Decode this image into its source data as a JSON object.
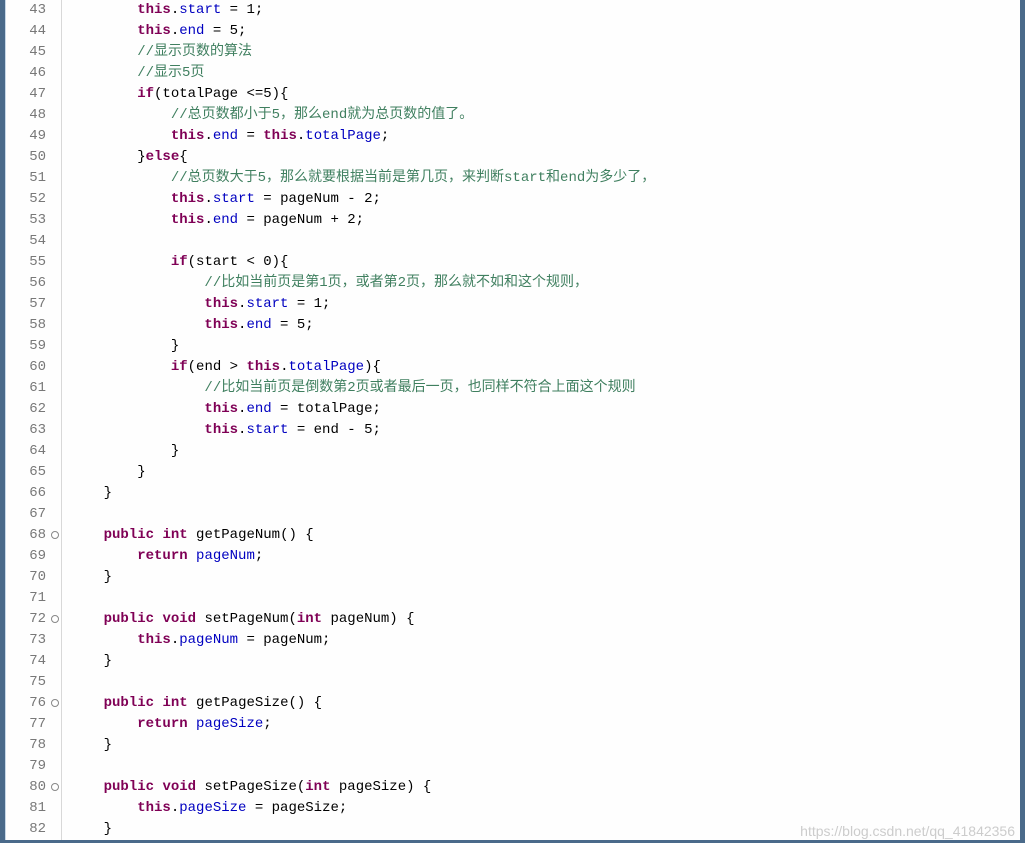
{
  "watermark": "https://blog.csdn.net/qq_41842356",
  "lineStart": 43,
  "lineEnd": 82,
  "foldMarkers": [
    68,
    72,
    76,
    80
  ],
  "code": [
    {
      "n": 43,
      "t": [
        {
          "c": "p",
          "v": "        "
        },
        {
          "c": "kw",
          "v": "this"
        },
        {
          "c": "p",
          "v": "."
        },
        {
          "c": "fld",
          "v": "start"
        },
        {
          "c": "p",
          "v": " = 1;"
        }
      ]
    },
    {
      "n": 44,
      "t": [
        {
          "c": "p",
          "v": "        "
        },
        {
          "c": "kw",
          "v": "this"
        },
        {
          "c": "p",
          "v": "."
        },
        {
          "c": "fld",
          "v": "end"
        },
        {
          "c": "p",
          "v": " = 5;"
        }
      ]
    },
    {
      "n": 45,
      "t": [
        {
          "c": "p",
          "v": "        "
        },
        {
          "c": "cm",
          "v": "//显示页数的算法"
        }
      ]
    },
    {
      "n": 46,
      "t": [
        {
          "c": "p",
          "v": "        "
        },
        {
          "c": "cm",
          "v": "//显示5页"
        }
      ]
    },
    {
      "n": 47,
      "t": [
        {
          "c": "p",
          "v": "        "
        },
        {
          "c": "kw",
          "v": "if"
        },
        {
          "c": "p",
          "v": "(totalPage <=5){"
        }
      ]
    },
    {
      "n": 48,
      "t": [
        {
          "c": "p",
          "v": "            "
        },
        {
          "c": "cm",
          "v": "//总页数都小于5，那么end就为总页数的值了。"
        }
      ]
    },
    {
      "n": 49,
      "t": [
        {
          "c": "p",
          "v": "            "
        },
        {
          "c": "kw",
          "v": "this"
        },
        {
          "c": "p",
          "v": "."
        },
        {
          "c": "fld",
          "v": "end"
        },
        {
          "c": "p",
          "v": " = "
        },
        {
          "c": "kw",
          "v": "this"
        },
        {
          "c": "p",
          "v": "."
        },
        {
          "c": "fld",
          "v": "totalPage"
        },
        {
          "c": "p",
          "v": ";"
        }
      ]
    },
    {
      "n": 50,
      "t": [
        {
          "c": "p",
          "v": "        }"
        },
        {
          "c": "kw",
          "v": "else"
        },
        {
          "c": "p",
          "v": "{"
        }
      ]
    },
    {
      "n": 51,
      "t": [
        {
          "c": "p",
          "v": "            "
        },
        {
          "c": "cm",
          "v": "//总页数大于5，那么就要根据当前是第几页，来判断start和end为多少了，"
        }
      ]
    },
    {
      "n": 52,
      "t": [
        {
          "c": "p",
          "v": "            "
        },
        {
          "c": "kw",
          "v": "this"
        },
        {
          "c": "p",
          "v": "."
        },
        {
          "c": "fld",
          "v": "start"
        },
        {
          "c": "p",
          "v": " = pageNum - 2;"
        }
      ]
    },
    {
      "n": 53,
      "t": [
        {
          "c": "p",
          "v": "            "
        },
        {
          "c": "kw",
          "v": "this"
        },
        {
          "c": "p",
          "v": "."
        },
        {
          "c": "fld",
          "v": "end"
        },
        {
          "c": "p",
          "v": " = pageNum + 2;"
        }
      ]
    },
    {
      "n": 54,
      "t": [
        {
          "c": "p",
          "v": ""
        }
      ]
    },
    {
      "n": 55,
      "t": [
        {
          "c": "p",
          "v": "            "
        },
        {
          "c": "kw",
          "v": "if"
        },
        {
          "c": "p",
          "v": "(start < 0){"
        }
      ]
    },
    {
      "n": 56,
      "t": [
        {
          "c": "p",
          "v": "                "
        },
        {
          "c": "cm",
          "v": "//比如当前页是第1页，或者第2页，那么就不如和这个规则，"
        }
      ]
    },
    {
      "n": 57,
      "t": [
        {
          "c": "p",
          "v": "                "
        },
        {
          "c": "kw",
          "v": "this"
        },
        {
          "c": "p",
          "v": "."
        },
        {
          "c": "fld",
          "v": "start"
        },
        {
          "c": "p",
          "v": " = 1;"
        }
      ]
    },
    {
      "n": 58,
      "t": [
        {
          "c": "p",
          "v": "                "
        },
        {
          "c": "kw",
          "v": "this"
        },
        {
          "c": "p",
          "v": "."
        },
        {
          "c": "fld",
          "v": "end"
        },
        {
          "c": "p",
          "v": " = 5;"
        }
      ]
    },
    {
      "n": 59,
      "t": [
        {
          "c": "p",
          "v": "            }"
        }
      ]
    },
    {
      "n": 60,
      "t": [
        {
          "c": "p",
          "v": "            "
        },
        {
          "c": "kw",
          "v": "if"
        },
        {
          "c": "p",
          "v": "(end > "
        },
        {
          "c": "kw",
          "v": "this"
        },
        {
          "c": "p",
          "v": "."
        },
        {
          "c": "fld",
          "v": "totalPage"
        },
        {
          "c": "p",
          "v": "){"
        }
      ]
    },
    {
      "n": 61,
      "t": [
        {
          "c": "p",
          "v": "                "
        },
        {
          "c": "cm",
          "v": "//比如当前页是倒数第2页或者最后一页，也同样不符合上面这个规则"
        }
      ]
    },
    {
      "n": 62,
      "t": [
        {
          "c": "p",
          "v": "                "
        },
        {
          "c": "kw",
          "v": "this"
        },
        {
          "c": "p",
          "v": "."
        },
        {
          "c": "fld",
          "v": "end"
        },
        {
          "c": "p",
          "v": " = totalPage;"
        }
      ]
    },
    {
      "n": 63,
      "t": [
        {
          "c": "p",
          "v": "                "
        },
        {
          "c": "kw",
          "v": "this"
        },
        {
          "c": "p",
          "v": "."
        },
        {
          "c": "fld",
          "v": "start"
        },
        {
          "c": "p",
          "v": " = end - 5;"
        }
      ]
    },
    {
      "n": 64,
      "t": [
        {
          "c": "p",
          "v": "            }"
        }
      ]
    },
    {
      "n": 65,
      "t": [
        {
          "c": "p",
          "v": "        }"
        }
      ]
    },
    {
      "n": 66,
      "t": [
        {
          "c": "p",
          "v": "    }"
        }
      ]
    },
    {
      "n": 67,
      "t": [
        {
          "c": "p",
          "v": ""
        }
      ]
    },
    {
      "n": 68,
      "t": [
        {
          "c": "p",
          "v": "    "
        },
        {
          "c": "kw",
          "v": "public"
        },
        {
          "c": "p",
          "v": " "
        },
        {
          "c": "kw",
          "v": "int"
        },
        {
          "c": "p",
          "v": " getPageNum() {"
        }
      ]
    },
    {
      "n": 69,
      "t": [
        {
          "c": "p",
          "v": "        "
        },
        {
          "c": "kw",
          "v": "return"
        },
        {
          "c": "p",
          "v": " "
        },
        {
          "c": "fld",
          "v": "pageNum"
        },
        {
          "c": "p",
          "v": ";"
        }
      ]
    },
    {
      "n": 70,
      "t": [
        {
          "c": "p",
          "v": "    }"
        }
      ]
    },
    {
      "n": 71,
      "t": [
        {
          "c": "p",
          "v": ""
        }
      ]
    },
    {
      "n": 72,
      "t": [
        {
          "c": "p",
          "v": "    "
        },
        {
          "c": "kw",
          "v": "public"
        },
        {
          "c": "p",
          "v": " "
        },
        {
          "c": "kw",
          "v": "void"
        },
        {
          "c": "p",
          "v": " setPageNum("
        },
        {
          "c": "kw",
          "v": "int"
        },
        {
          "c": "p",
          "v": " pageNum) {"
        }
      ]
    },
    {
      "n": 73,
      "t": [
        {
          "c": "p",
          "v": "        "
        },
        {
          "c": "kw",
          "v": "this"
        },
        {
          "c": "p",
          "v": "."
        },
        {
          "c": "fld",
          "v": "pageNum"
        },
        {
          "c": "p",
          "v": " = pageNum;"
        }
      ]
    },
    {
      "n": 74,
      "t": [
        {
          "c": "p",
          "v": "    }"
        }
      ]
    },
    {
      "n": 75,
      "t": [
        {
          "c": "p",
          "v": ""
        }
      ]
    },
    {
      "n": 76,
      "t": [
        {
          "c": "p",
          "v": "    "
        },
        {
          "c": "kw",
          "v": "public"
        },
        {
          "c": "p",
          "v": " "
        },
        {
          "c": "kw",
          "v": "int"
        },
        {
          "c": "p",
          "v": " getPageSize() {"
        }
      ]
    },
    {
      "n": 77,
      "t": [
        {
          "c": "p",
          "v": "        "
        },
        {
          "c": "kw",
          "v": "return"
        },
        {
          "c": "p",
          "v": " "
        },
        {
          "c": "fld",
          "v": "pageSize"
        },
        {
          "c": "p",
          "v": ";"
        }
      ]
    },
    {
      "n": 78,
      "t": [
        {
          "c": "p",
          "v": "    }"
        }
      ]
    },
    {
      "n": 79,
      "t": [
        {
          "c": "p",
          "v": ""
        }
      ]
    },
    {
      "n": 80,
      "t": [
        {
          "c": "p",
          "v": "    "
        },
        {
          "c": "kw",
          "v": "public"
        },
        {
          "c": "p",
          "v": " "
        },
        {
          "c": "kw",
          "v": "void"
        },
        {
          "c": "p",
          "v": " setPageSize("
        },
        {
          "c": "kw",
          "v": "int"
        },
        {
          "c": "p",
          "v": " pageSize) {"
        }
      ]
    },
    {
      "n": 81,
      "t": [
        {
          "c": "p",
          "v": "        "
        },
        {
          "c": "kw",
          "v": "this"
        },
        {
          "c": "p",
          "v": "."
        },
        {
          "c": "fld",
          "v": "pageSize"
        },
        {
          "c": "p",
          "v": " = pageSize;"
        }
      ]
    },
    {
      "n": 82,
      "t": [
        {
          "c": "p",
          "v": "    }"
        }
      ]
    }
  ]
}
